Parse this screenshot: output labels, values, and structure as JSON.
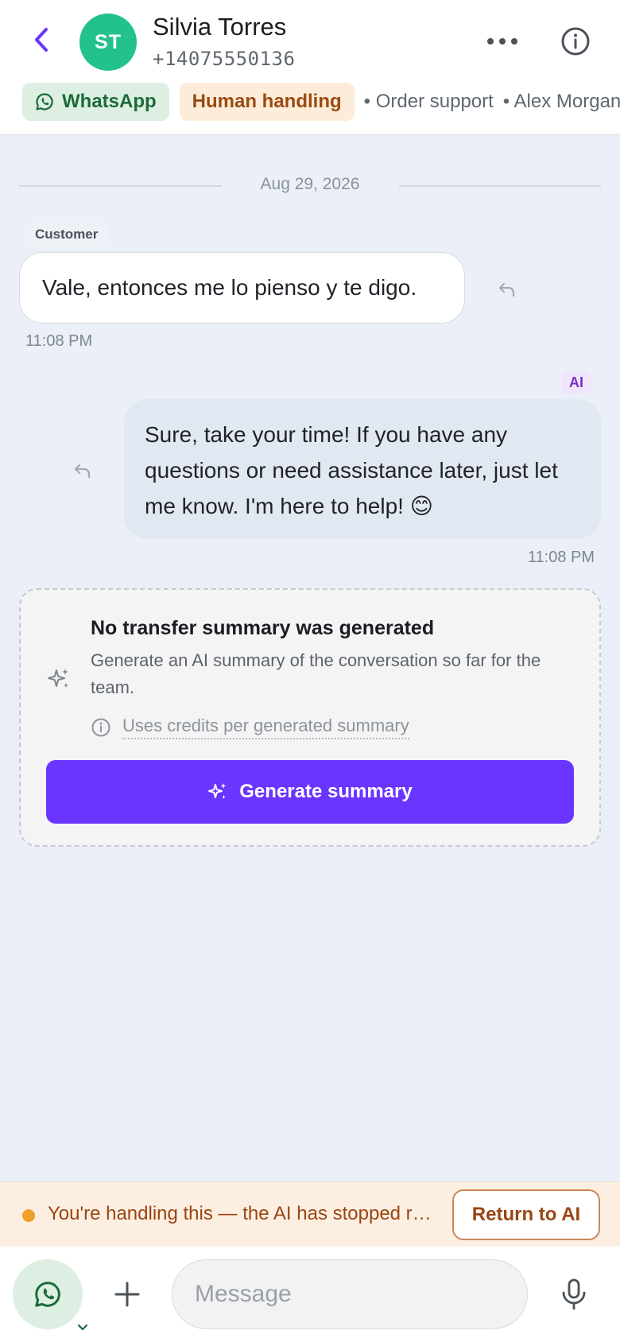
{
  "header": {
    "contact_name": "Silvia Torres",
    "contact_phone": "+14075550136",
    "avatar_initials": "ST",
    "avatar_color": "#22c28a"
  },
  "tags": {
    "channel": "WhatsApp",
    "status": "Human handling",
    "topic": "• Order support",
    "agent": "• Alex Morgan"
  },
  "conversation": {
    "date": "Aug 29, 2026",
    "messages": [
      {
        "sender_label": "Customer",
        "text": "Vale, entonces me lo pienso y te digo.",
        "time": "11:08 PM"
      },
      {
        "sender_label": "AI",
        "text": "Sure, take your time! If you have any questions or need assistance later, just let me know. I'm here to help! 😊",
        "time": "11:08 PM"
      }
    ]
  },
  "summary_card": {
    "title": "No transfer summary was generated",
    "description": "Generate an AI summary of the conversation so far for the team.",
    "credits_note": "Uses credits per generated summary",
    "button_label": "Generate summary"
  },
  "banner": {
    "text": "You're handling this — the AI has stopped replying",
    "button_label": "Return to AI"
  },
  "composer": {
    "placeholder": "Message"
  },
  "colors": {
    "accent": "#6a35ff",
    "whatsapp_green": "#1c6b38",
    "human_orange": "#9a4b12",
    "banner_dot": "#f0a02c"
  },
  "icons": [
    "chevron-left-icon",
    "more-icon",
    "info-icon",
    "whatsapp-icon",
    "reply-icon",
    "sparkle-icon",
    "plus-icon",
    "microphone-icon"
  ]
}
